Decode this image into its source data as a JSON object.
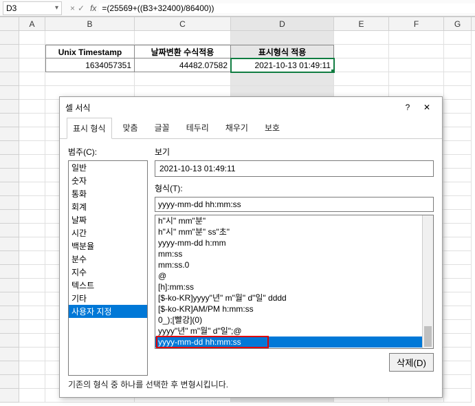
{
  "formula_bar": {
    "name_box": "D3",
    "fx": "fx",
    "formula": "=(25569+((B3+32400)/86400))"
  },
  "columns": {
    "A": "A",
    "B": "B",
    "C": "C",
    "D": "D",
    "E": "E",
    "F": "F",
    "G": "G"
  },
  "table": {
    "headers": {
      "B": "Unix Timestamp",
      "C": "날짜변환 수식적용",
      "D": "표시형식 적용"
    },
    "row": {
      "B": "1634057351",
      "C": "44482.07582",
      "D": "2021-10-13 01:49:11"
    }
  },
  "dialog": {
    "title": "셀 서식",
    "help": "?",
    "close": "✕",
    "tabs": [
      "표시 형식",
      "맞춤",
      "글꼴",
      "테두리",
      "채우기",
      "보호"
    ],
    "category_label": "범주(C):",
    "categories": [
      "일반",
      "숫자",
      "통화",
      "회계",
      "날짜",
      "시간",
      "백분율",
      "분수",
      "지수",
      "텍스트",
      "기타",
      "사용자 지정"
    ],
    "selected_category_index": 11,
    "preview_label": "보기",
    "preview_value": "2021-10-13 01:49:11",
    "format_label": "형식(T):",
    "format_value": "yyyy-mm-dd hh:mm:ss",
    "format_list": [
      "h\"시\" mm\"분\"",
      "h\"시\" mm\"분\" ss\"초\"",
      "yyyy-mm-dd h:mm",
      "mm:ss",
      "mm:ss.0",
      "@",
      "[h]:mm:ss",
      "[$-ko-KR]yyyy\"년\" m\"월\" d\"일\" dddd",
      "[$-ko-KR]AM/PM h:mm:ss",
      "0_);[빨강](0)",
      "yyyy\"년\" m\"월\" d\"일\";@",
      "yyyy-mm-dd hh:mm:ss"
    ],
    "selected_format_index": 11,
    "delete_label": "삭제(D)",
    "hint": "기존의 형식 중 하나를 선택한 후 변형시킵니다."
  }
}
